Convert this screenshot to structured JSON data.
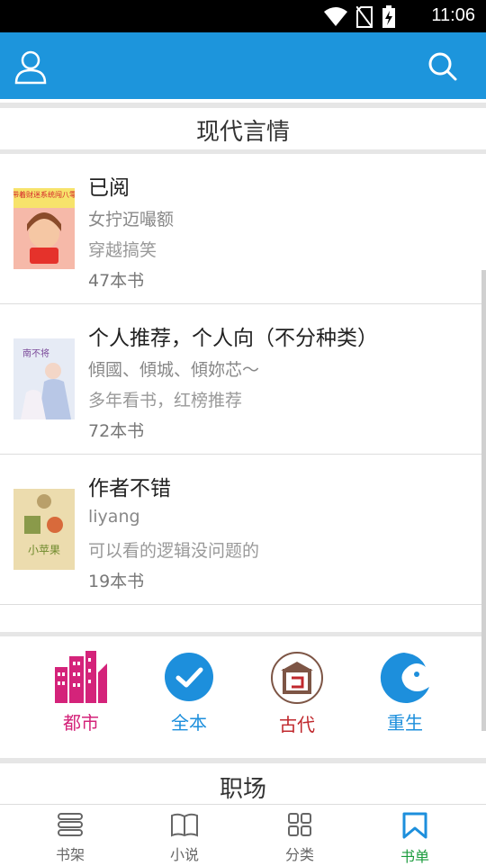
{
  "status": {
    "time": "11:06"
  },
  "sections": {
    "top_title": "现代言情",
    "bottom_title": "职场"
  },
  "booklists": [
    {
      "title": "已阅",
      "author": "女拧迈嘬额",
      "desc": "穿越搞笑",
      "count": "47本书",
      "cover_text": "带着财迷系统闯八零"
    },
    {
      "title": "个人推荐，个人向（不分种类）",
      "author": "傾國、傾城、傾妳芯～",
      "desc": "多年看书，红榜推荐",
      "count": "72本书",
      "cover_text": "南不将"
    },
    {
      "title": "作者不错",
      "author": "liyang",
      "desc": "可以看的逻辑没问题的",
      "count": "19本书",
      "cover_text": "小苹果"
    }
  ],
  "categories": [
    {
      "label": "都市",
      "color": "#d4237a",
      "icon": "city-icon"
    },
    {
      "label": "全本",
      "color": "#1d8fdc",
      "icon": "check-circle-icon"
    },
    {
      "label": "古代",
      "color": "#c0282d",
      "icon": "ancient-building-icon"
    },
    {
      "label": "重生",
      "color": "#1d8fdc",
      "icon": "cloud-wave-icon"
    }
  ],
  "tabs": [
    {
      "label": "书架",
      "icon": "bookshelf-icon"
    },
    {
      "label": "小说",
      "icon": "book-icon"
    },
    {
      "label": "分类",
      "icon": "grid-icon"
    },
    {
      "label": "书单",
      "icon": "bookmark-icon"
    }
  ],
  "colors": {
    "header": "#1d95dc",
    "active_tab": "#1b9b3d"
  }
}
